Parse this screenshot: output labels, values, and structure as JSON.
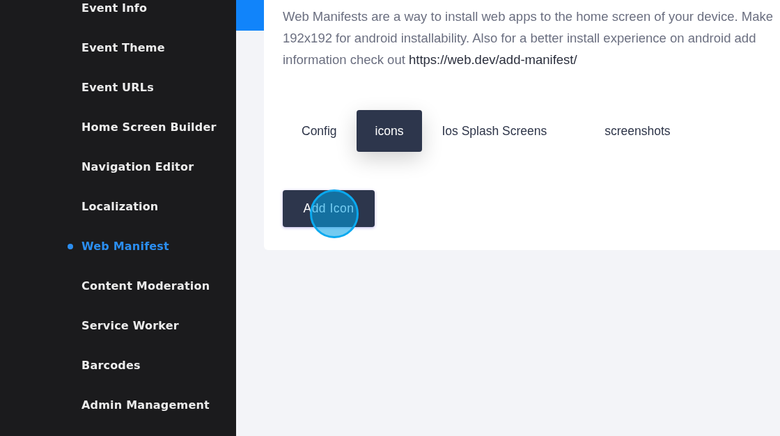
{
  "sidebar": {
    "items": [
      {
        "label": "Event Info",
        "selected": false
      },
      {
        "label": "Event Theme",
        "selected": false
      },
      {
        "label": "Event URLs",
        "selected": false
      },
      {
        "label": "Home Screen Builder",
        "selected": false
      },
      {
        "label": "Navigation Editor",
        "selected": false
      },
      {
        "label": "Localization",
        "selected": false
      },
      {
        "label": "Web Manifest",
        "selected": true
      },
      {
        "label": "Content Moderation",
        "selected": false
      },
      {
        "label": "Service Worker",
        "selected": false
      },
      {
        "label": "Barcodes",
        "selected": false
      },
      {
        "label": "Admin Management",
        "selected": false
      }
    ]
  },
  "description": {
    "lines": [
      "Web Manifests are a way to install web apps to the home screen of your device. Make",
      "192x192 for android installability. Also for a better install experience on android add",
      "information check out"
    ],
    "link": "https://web.dev/add-manifest/"
  },
  "tabs": [
    {
      "label": "Config",
      "selected": false
    },
    {
      "label": "icons",
      "selected": true
    },
    {
      "label": "Ios Splash Screens",
      "selected": false
    },
    {
      "label": "screenshots",
      "selected": false
    }
  ],
  "add_button": {
    "label": "Add Icon"
  }
}
